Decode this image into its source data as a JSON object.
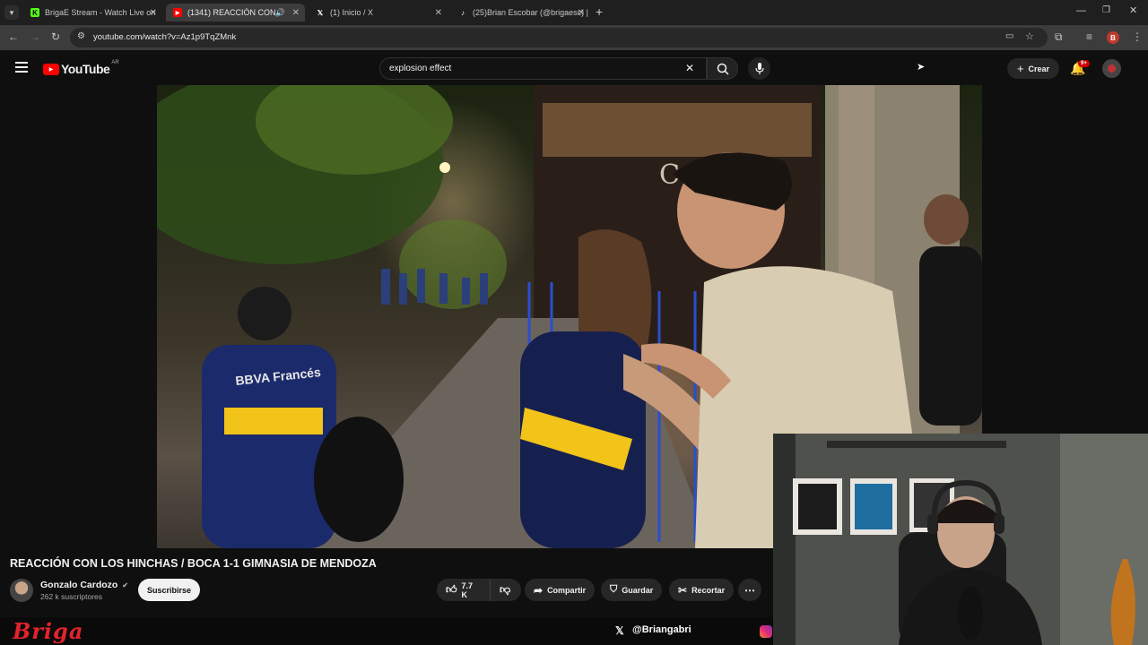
{
  "browser": {
    "tabs": [
      {
        "title": "BrigaE Stream - Watch Live on",
        "favicon": "kick-icon",
        "active": false
      },
      {
        "title": "(1341) REACCIÓN CON LOS",
        "favicon": "youtube-icon",
        "active": true
      },
      {
        "title": "(1) Inicio / X",
        "favicon": "x-icon",
        "active": false
      },
      {
        "title": "(25)Brian Escobar (@brigaesc) |",
        "favicon": "tiktok-icon",
        "active": false
      }
    ],
    "url": "youtube.com/watch?v=Az1p9TqZMnk",
    "profile_initial": "B"
  },
  "youtube": {
    "logo_text": "YouTube",
    "region": "AR",
    "search_value": "explosion effect",
    "create_label": "Crear",
    "notifications_badge": "9+"
  },
  "video": {
    "title": "REACCIÓN CON LOS HINCHAS / BOCA 1-1 GIMNASIA DE MENDOZA",
    "channel": "Gonzalo Cardozo",
    "subscribers": "262 k suscriptores",
    "subscribe_label": "Suscribirse",
    "likes": "7.7 K",
    "share_label": "Compartir",
    "save_label": "Guardar",
    "clip_label": "Recortar",
    "jersey_text": "BBVA Francés"
  },
  "overlay": {
    "brand": "Briga",
    "handle": "@Briangabri"
  },
  "colors": {
    "yt_red": "#ff0000",
    "kick_green": "#53fc18",
    "overlay_red": "#e3232b",
    "boca_blue": "#1b2a6b",
    "boca_yellow": "#f2c318"
  }
}
